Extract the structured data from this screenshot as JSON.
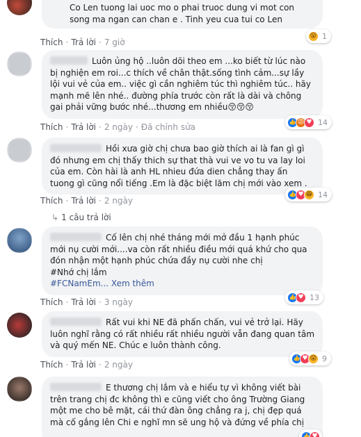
{
  "actions": {
    "like": "Thích",
    "reply": "Trả lời",
    "dot": "·"
  },
  "comments": [
    {
      "text": "Co Len tuong lai uoc mo o phai truoc dung vi mot con song ma ngan can chan e . Tinh yeu cua tui co Len",
      "time": "7 giờ",
      "reactions": {
        "icons": [
          "wow-icon"
        ],
        "count": "1"
      }
    },
    {
      "text": "Luôn ủng hộ ..luôn dõi theo em ...ko biết từ lúc nào bị nghiện em roi...c thích về chân thật.sống tình cảm...sự lầy lội vui vẻ của em.. việc gì cần nghiêm túc thì nghiêm túc.. hãy mạnh mẽ lên nhé.. đường phía trước còn rất là dài và chông gai phải vững bước nhé...thương em nhiều😚😚😚",
      "time": "2 ngày",
      "edited": "Đã chỉnh sửa",
      "reactions": {
        "icons": [
          "like-icon",
          "angry-icon",
          "love-icon"
        ],
        "count": "14"
      }
    },
    {
      "text": "Hồi xưa giờ chị chưa bao giờ thích ai là fan gì gì đó nhưng em chị thấy thich sự that thà vui ve vo tu va lay loi của em. Còn hài là anh HL nhieu đứa dien chẳng thay ấn tuong gì cũng nổi tiếng .Em là đặc biệt lăm chị mới vào xem .",
      "time": "2 ngày",
      "reactions": {
        "icons": [
          "like-icon",
          "love-icon",
          "haha-icon"
        ],
        "count": "14"
      },
      "reply_count": "1 câu trả lời"
    },
    {
      "text": "Cố lên chị nhé tháng mới mở đầu 1 hạnh phúc mới nụ cười mới....va còn rất nhiều điều mới quá khứ cho qua đón nhận một hạnh phúc chứa đầy nụ cười nhe chị",
      "hashtags": [
        "#Nhớ chị lắm",
        "#FCNamEm..."
      ],
      "see_more": "Xem thêm",
      "time": "3 ngày",
      "reactions": {
        "icons": [
          "like-icon",
          "love-icon"
        ],
        "count": "13"
      }
    },
    {
      "text": "Rất vui khi NE đã phấn chấn, vui vẻ trở lại. Hãy luôn nghĩ rằng có rất nhiều rất nhiều người vẫn đang quan tâm và quý mến NE. Chúc e luôn thành công.",
      "time": "2 ngày",
      "reactions": {
        "icons": [
          "like-icon",
          "love-icon",
          "wow-icon"
        ],
        "count": "9"
      }
    },
    {
      "text": "E thương chị lắm và e hiểu tự vì không viết bài trên trang chị đc không thì e cũng viết cho ông Trường Giang một me cho bê mặt, cái thứ đàn ông chẳng ra j, chị đẹp quá mà cố gắng lên Chi e nghĩ mn sẽ ung hộ và đứng về phía chị",
      "reactions": {
        "icons": [
          "like-icon",
          "love-icon"
        ],
        "count": ""
      }
    }
  ],
  "colors": {
    "bubble": "#f2f3f5",
    "link": "#385898",
    "meta": "#90949c",
    "like": "#1877f2",
    "love": "#f33e58",
    "haha": "#f7b125",
    "angry": "#e9710f"
  }
}
